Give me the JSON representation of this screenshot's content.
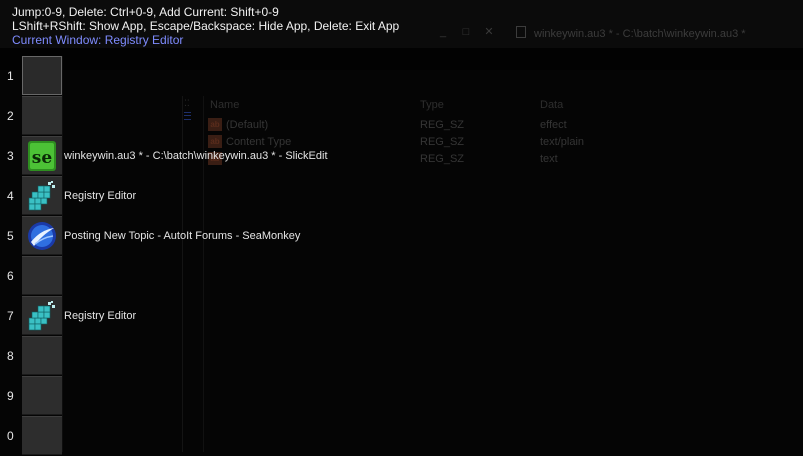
{
  "hints": {
    "line1": "Jump:0-9,   Delete: Ctrl+0-9,   Add Current: Shift+0-9",
    "line2": "LShift+RShift: Show App,  Escape/Backspace: Hide App,  Delete: Exit App",
    "current_window": "Current Window: Registry Editor"
  },
  "background_app": {
    "tab_title": "winkeywin.au3 * - C:\\batch\\winkeywin.au3 *",
    "columns": [
      "Name",
      "Type",
      "Data"
    ],
    "rows": [
      {
        "name": "(Default)",
        "type": "REG_SZ",
        "data": "effect"
      },
      {
        "name": "Content Type",
        "type": "REG_SZ",
        "data": "text/plain"
      },
      {
        "name": "",
        "type": "REG_SZ",
        "data": "text"
      }
    ]
  },
  "slots": [
    {
      "number": "1",
      "title": "",
      "icon": "empty-slot"
    },
    {
      "number": "2",
      "title": "",
      "icon": "none"
    },
    {
      "number": "3",
      "title": "winkeywin.au3 * - C:\\batch\\winkeywin.au3 * - SlickEdit",
      "icon": "slickedit-icon"
    },
    {
      "number": "4",
      "title": "Registry Editor",
      "icon": "registry-editor-icon"
    },
    {
      "number": "5",
      "title": "Posting New Topic - AutoIt Forums - SeaMonkey",
      "icon": "seamonkey-icon"
    },
    {
      "number": "6",
      "title": "",
      "icon": "none"
    },
    {
      "number": "7",
      "title": "Registry Editor",
      "icon": "registry-editor-icon"
    },
    {
      "number": "8",
      "title": "",
      "icon": "none"
    },
    {
      "number": "9",
      "title": "",
      "icon": "none"
    },
    {
      "number": "0",
      "title": "",
      "icon": "none"
    }
  ],
  "colors": {
    "current_window_text": "#7f8cff",
    "slot_background": "#2d2d2d",
    "page_background": "#050505"
  }
}
